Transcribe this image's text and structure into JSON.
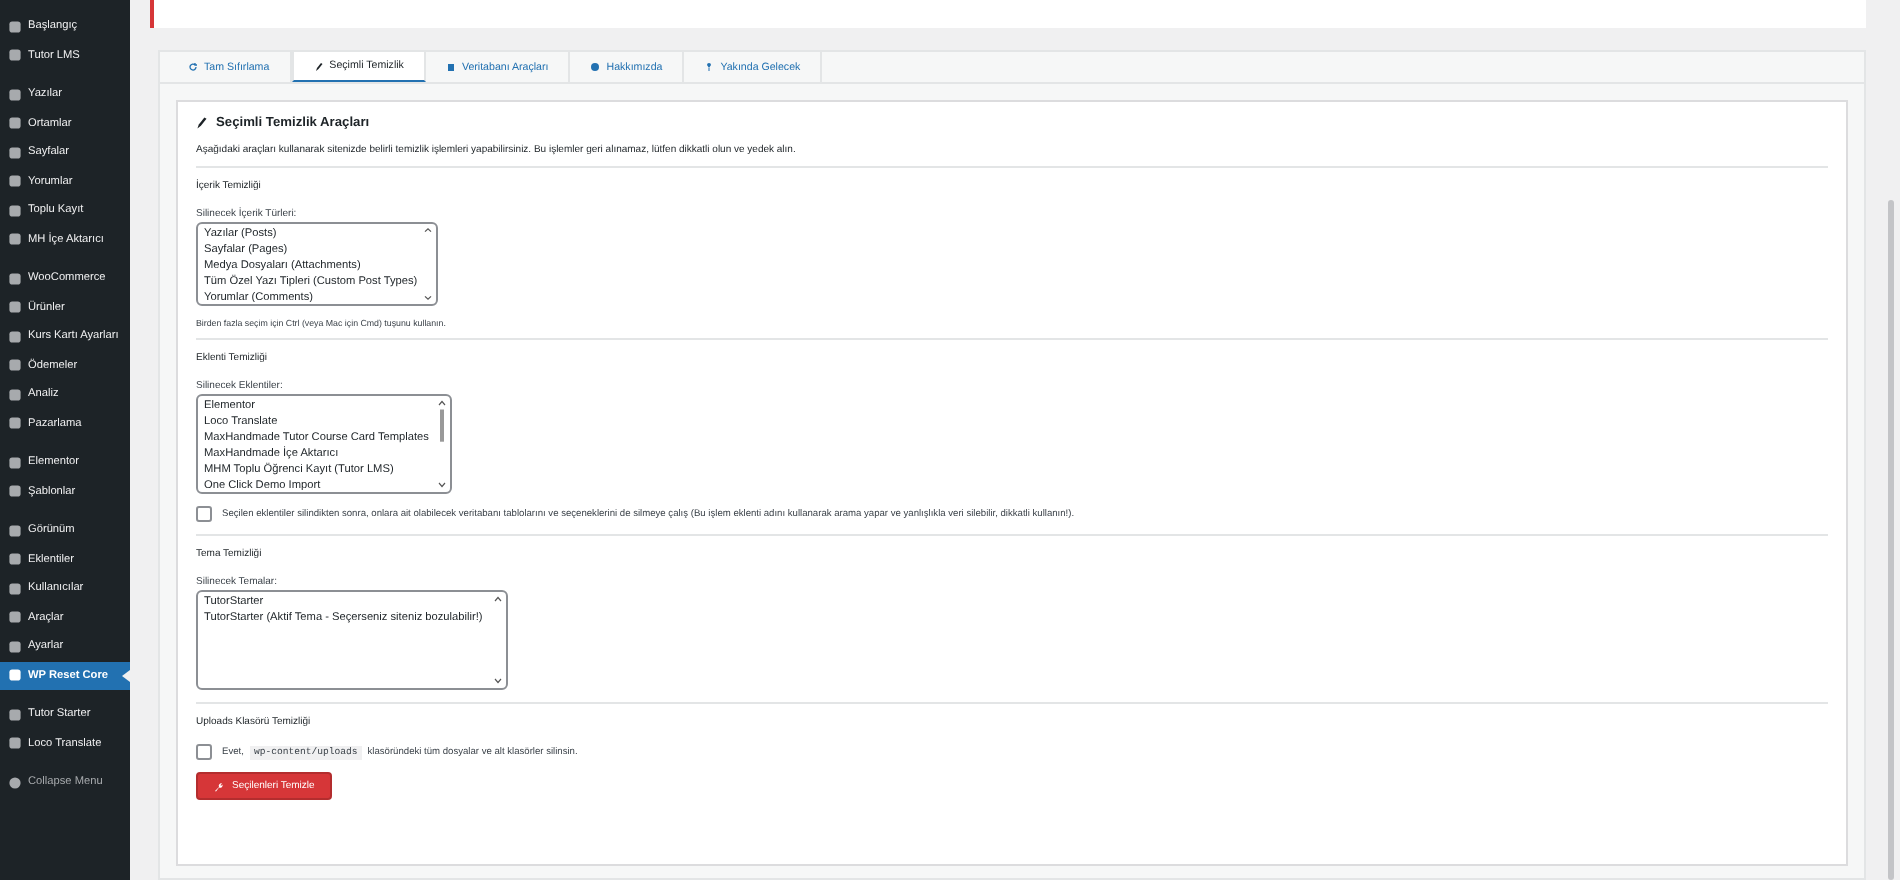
{
  "sidebar": {
    "groups": [
      [
        {
          "label": "Başlangıç",
          "selected": false
        },
        {
          "label": "Tutor LMS",
          "selected": false
        }
      ],
      [
        {
          "label": "Yazılar",
          "selected": false
        },
        {
          "label": "Ortamlar",
          "selected": false
        },
        {
          "label": "Sayfalar",
          "selected": false
        },
        {
          "label": "Yorumlar",
          "selected": false
        },
        {
          "label": "Toplu Kayıt",
          "selected": false
        },
        {
          "label": "MH İçe Aktarıcı",
          "selected": false
        }
      ],
      [
        {
          "label": "WooCommerce",
          "selected": false
        },
        {
          "label": "Ürünler",
          "selected": false
        },
        {
          "label": "Kurs Kartı Ayarları",
          "selected": false
        },
        {
          "label": "Ödemeler",
          "selected": false
        },
        {
          "label": "Analiz",
          "selected": false
        },
        {
          "label": "Pazarlama",
          "selected": false
        }
      ],
      [
        {
          "label": "Elementor",
          "selected": false
        },
        {
          "label": "Şablonlar",
          "selected": false
        }
      ],
      [
        {
          "label": "Görünüm",
          "selected": false
        },
        {
          "label": "Eklentiler",
          "selected": false
        },
        {
          "label": "Kullanıcılar",
          "selected": false
        },
        {
          "label": "Araçlar",
          "selected": false
        },
        {
          "label": "Ayarlar",
          "selected": false
        },
        {
          "label": "WP Reset Core",
          "selected": true
        }
      ],
      [
        {
          "label": "Tutor Starter",
          "selected": false
        },
        {
          "label": "Loco Translate",
          "selected": false
        }
      ]
    ],
    "collapse": "Collapse Menu"
  },
  "tabs": [
    {
      "label": "Tam Sıfırlama",
      "selected": false
    },
    {
      "label": "Seçimli Temizlik",
      "selected": true
    },
    {
      "label": "Veritabanı Araçları",
      "selected": false
    },
    {
      "label": "Hakkımızda",
      "selected": false
    },
    {
      "label": "Yakında Gelecek",
      "selected": false
    }
  ],
  "panel": {
    "title": "Seçimli Temizlik Araçları",
    "intro": "Aşağıdaki araçları kullanarak sitenizde belirli temizlik işlemleri yapabilirsiniz. Bu işlemler geri alınamaz, lütfen dikkatli olun ve yedek alın.",
    "sections": [
      {
        "kind": "list",
        "title": "İçerik Temizliği",
        "list_label": "Silinecek İçerik Türleri:",
        "options": [
          "Yazılar (Posts)",
          "Sayfalar (Pages)",
          "Medya Dosyaları (Attachments)",
          "Tüm Özel Yazı Tipleri (Custom Post Types)",
          "Yorumlar (Comments)"
        ],
        "hint": "Birden fazla seçim için Ctrl (veya Mac için Cmd) tuşunu kullanın."
      },
      {
        "kind": "list",
        "title": "Eklenti Temizliği",
        "list_label": "Silinecek Eklentiler:",
        "options": [
          "Elementor",
          "Loco Translate",
          "MaxHandmade Tutor Course Card Templates",
          "MaxHandmade İçe Aktarıcı",
          "MHM Toplu Öğrenci Kayıt (Tutor LMS)",
          "One Click Demo Import"
        ],
        "checkbox": {
          "label": "Seçilen eklentiler silindikten sonra, onlara ait olabilecek veritabanı tablolarını ve seçeneklerini de silmeye çalış (Bu işlem eklenti adını kullanarak arama yapar ve yanlışlıkla veri silebilir, dikkatli kullanın!).",
          "checked": false
        }
      },
      {
        "kind": "list",
        "title": "Tema Temizliği",
        "list_label": "Silinecek Temalar:",
        "options": [
          "TutorStarter",
          "TutorStarter (Aktif Tema - Seçerseniz siteniz bozulabilir!)"
        ]
      },
      {
        "kind": "uploads",
        "title": "Uploads Klasörü Temizliği",
        "checkbox": {
          "before": "Evet,",
          "code": "wp-content/uploads",
          "after": "klasöründeki tüm dosyalar ve alt klasörler silinsin.",
          "checked": false
        }
      }
    ],
    "button": "Seçilenleri Temizle"
  }
}
